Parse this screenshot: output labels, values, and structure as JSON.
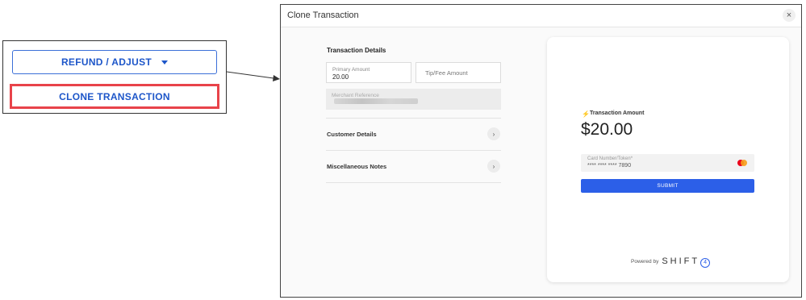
{
  "left_panel": {
    "refund_label": "REFUND / ADJUST",
    "clone_label": "CLONE TRANSACTION"
  },
  "modal": {
    "title": "Clone Transaction",
    "close_glyph": "×",
    "transaction_details": {
      "title": "Transaction Details",
      "primary_amount_label": "Primary Amount",
      "primary_amount_value": "20.00",
      "tip_fee_placeholder": "Tip/Fee Amount",
      "merchant_reference_label": "Merchant Reference"
    },
    "rows": [
      {
        "label": "Customer Details",
        "chevron": "›"
      },
      {
        "label": "Miscellaneous Notes",
        "chevron": "›"
      }
    ],
    "payment": {
      "amount_label": "Transaction Amount",
      "amount": "$20.00",
      "card_label": "Card Number/Token*",
      "card_value": "**** **** **** 7890",
      "submit_label": "SUBMIT",
      "powered_by": "Powered by",
      "brand": "SHIFT",
      "brand_digit": "4"
    }
  },
  "colors": {
    "accent_blue": "#1d56c9",
    "highlight_red": "#e8434a",
    "submit_blue": "#2c5fe8"
  },
  "icons": [
    "caret-down-icon",
    "close-icon",
    "chevron-right-icon",
    "bolt-icon",
    "mastercard-icon",
    "arrow-icon"
  ]
}
